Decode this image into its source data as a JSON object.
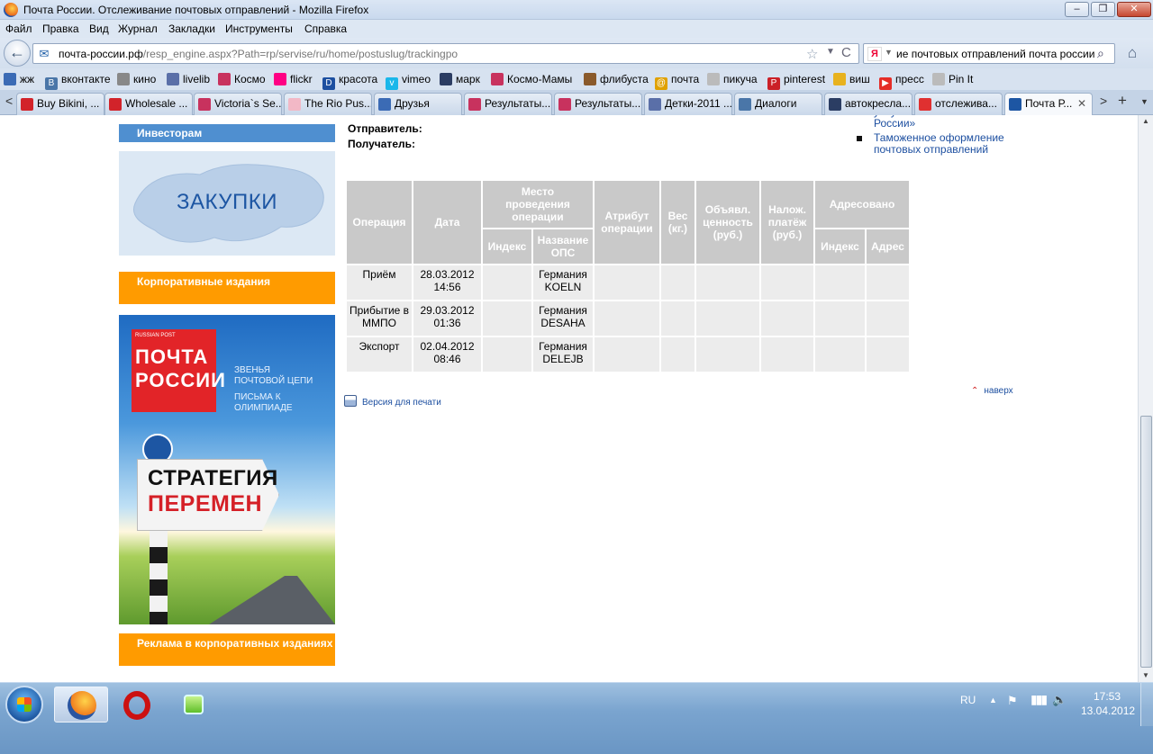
{
  "window": {
    "title": "Почта России. Отслеживание почтовых отправлений - Mozilla Firefox",
    "controls": {
      "minimize": "–",
      "maximize": "❐",
      "close": "✕"
    }
  },
  "menu": [
    "Файл",
    "Правка",
    "Вид",
    "Журнал",
    "Закладки",
    "Инструменты",
    "Справка"
  ],
  "navbar": {
    "back_icon": "←",
    "url_host": "почта-россии.рф",
    "url_path": "/resp_engine.aspx?Path=rp/servise/ru/home/postuslug/trackingpo",
    "star_icon": "☆",
    "dropdown_icon": "▼",
    "reload_icon": "C",
    "search_engine": "Я",
    "search_query": "ие почтовых отправлений почта россии",
    "search_icon": "⌕",
    "home_icon": "⌂"
  },
  "bookmarks": [
    {
      "label": "жж",
      "icon": "user-icon",
      "color": "#3b6bb5"
    },
    {
      "label": "вконтакте",
      "icon": "vk-icon",
      "color": "#4a76a8"
    },
    {
      "label": "кино",
      "icon": "film-icon",
      "color": "#888888"
    },
    {
      "label": "livelib",
      "icon": "book-icon",
      "color": "#5a6fa8"
    },
    {
      "label": "Космо",
      "icon": "cosmo-icon",
      "color": "#c8325e"
    },
    {
      "label": "flickr",
      "icon": "flickr-icon",
      "color": "#ff0084"
    },
    {
      "label": "красота",
      "icon": "d-icon",
      "color": "#1d4fa0"
    },
    {
      "label": "vimeo",
      "icon": "vimeo-icon",
      "color": "#1ab7ea"
    },
    {
      "label": "марк",
      "icon": "mail-icon",
      "color": "#2b3d63"
    },
    {
      "label": "Космо-Мамы",
      "icon": "cosmo-icon",
      "color": "#c8325e"
    },
    {
      "label": "флибуста",
      "icon": "coffee-icon",
      "color": "#8a5a2b"
    },
    {
      "label": "почта",
      "icon": "mail-at-icon",
      "color": "#e0a100"
    },
    {
      "label": "пикуча",
      "icon": "page-icon",
      "color": "#bbbbbb"
    },
    {
      "label": "pinterest",
      "icon": "pinterest-icon",
      "color": "#cb2027"
    },
    {
      "label": "виш",
      "icon": "gift-icon",
      "color": "#e8b21e"
    },
    {
      "label": "пресс",
      "icon": "youtube-icon",
      "color": "#e52d27"
    },
    {
      "label": "Pin It",
      "icon": "page-icon",
      "color": "#bbbbbb"
    }
  ],
  "tabs": [
    {
      "label": "Buy Bikini, ...",
      "color": "#d2232a"
    },
    {
      "label": "Wholesale ...",
      "color": "#d2232a"
    },
    {
      "label": "Victoria`s Se...",
      "color": "#c8325e"
    },
    {
      "label": "The Rio Pus...",
      "color": "#f2b8c6"
    },
    {
      "label": "Друзья",
      "color": "#3b6bb5"
    },
    {
      "label": "Результаты...",
      "color": "#c8325e"
    },
    {
      "label": "Результаты...",
      "color": "#c8325e"
    },
    {
      "label": "Детки-2011 ...",
      "color": "#5a6fa8"
    },
    {
      "label": "Диалоги",
      "color": "#4a76a8"
    },
    {
      "label": "автокресла...",
      "color": "#2b3d63"
    },
    {
      "label": "отслежива...",
      "color": "#e03030"
    },
    {
      "label": "Почта Р...",
      "color": "#1d56a3"
    }
  ],
  "tab_close": "✕",
  "tab_scroll_left": "<",
  "tab_scroll_right": ">",
  "tab_new": "+",
  "tab_list": "▼",
  "sidebar": {
    "investors": "Инвесторам",
    "zakupki": "ЗАКУПКИ",
    "corp_editions": "Корпоративные издания",
    "ads_editions": "Реклама в корпоративных изданиях",
    "magazine": {
      "russian_post": "RUSSIAN POST",
      "brand": "ПОЧТА РОССИИ",
      "line1": "ЗВЕНЬЯ ПОЧТОВОЙ ЦЕПИ",
      "line2": "ПИСЬМА К ОЛИМПИАДЕ",
      "sign_top": "СТРАТЕГИЯ",
      "sign_bottom": "ПЕРЕМЕН"
    }
  },
  "content": {
    "sender_label": "Отправитель:",
    "receiver_label": "Получатель:",
    "print_link": "Версия для печати",
    "top_link": "наверх",
    "top_icon": "⌃"
  },
  "table": {
    "headers": {
      "operation": "Операция",
      "date": "Дата",
      "place": "Место проведения операции",
      "index": "Индекс",
      "ops_name": "Название ОПС",
      "attribute": "Атрибут операции",
      "weight": "Вес (кг.)",
      "declared": "Объявл. ценность (руб.)",
      "cod": "Налож. платёж (руб.)",
      "addressed": "Адресовано",
      "addr_index": "Индекс",
      "addr_address": "Адрес"
    },
    "rows": [
      {
        "operation": "Приём",
        "date": "28.03.2012 14:56",
        "index": "",
        "ops_name": "Германия KOELN",
        "attribute": "",
        "weight": "",
        "declared": "",
        "cod": "",
        "addr_index": "",
        "addr_address": ""
      },
      {
        "operation": "Прибытие в ММПО",
        "date": "29.03.2012 01:36",
        "index": "",
        "ops_name": "Германия DESAHA",
        "attribute": "",
        "weight": "",
        "declared": "",
        "cod": "",
        "addr_index": "",
        "addr_address": ""
      },
      {
        "operation": "Экспорт",
        "date": "02.04.2012 08:46",
        "index": "",
        "ops_name": "Германия DELEJB",
        "attribute": "",
        "weight": "",
        "declared": "",
        "cod": "",
        "addr_index": "",
        "addr_address": ""
      }
    ]
  },
  "right_links": {
    "partial": "услугам ФГУП «Почта России»",
    "customs": "Таможенное оформление почтовых отправлений"
  },
  "taskbar": {
    "lang": "RU",
    "time": "17:53",
    "date": "13.04.2012",
    "tray_up_icon": "▲",
    "flag_icon": "⚑",
    "network_icon": "▮▮▮",
    "volume_icon": "🔈"
  }
}
